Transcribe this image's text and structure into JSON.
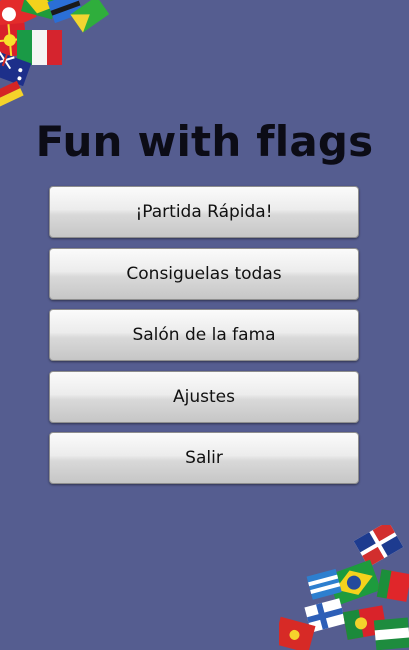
{
  "app": {
    "title": "Fun with flags"
  },
  "menu": {
    "quick_game": "¡Partida Rápida!",
    "collect_all": "Consiguelas todas",
    "hall_of_fame": "Salón de la fama",
    "settings": "Ajustes",
    "exit": "Salir"
  },
  "colors": {
    "background": "#555d90",
    "button_top": "#fbfbfb",
    "button_bottom": "#c6c6c6",
    "title_text": "#0c0c16"
  },
  "icons": {
    "top_left": "flags-decoration-icon",
    "bottom_right": "flags-decoration-icon"
  }
}
